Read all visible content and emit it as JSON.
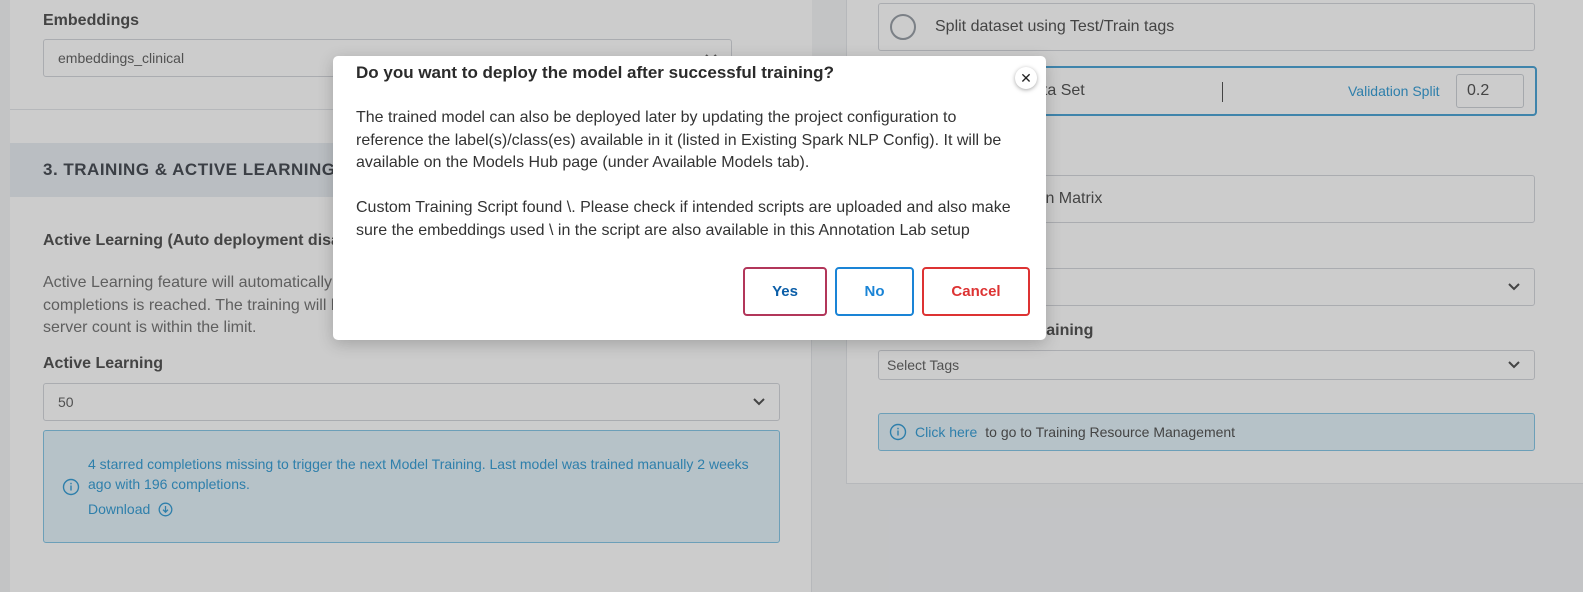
{
  "embeddings": {
    "label": "Embeddings",
    "value": "embeddings_clinical"
  },
  "training": {
    "section_title": "3. TRAINING & ACTIVE LEARNING",
    "active_learning_heading": "Active Learning  (Auto deployment disab",
    "description_lines": [
      "Active Learning feature will automatically",
      "completions is reached. The training will l",
      "server count is within the limit."
    ],
    "active_learning_label": "Active Learning",
    "active_learning_value": "50",
    "info_text": "4 starred completions missing to trigger the next Model Training. Last model was trained manually 2 weeks ago with 196 completions.",
    "download_label": "Download"
  },
  "right_panel": {
    "split_option_label": "Split dataset using Test/Train tags",
    "dataset_partial": "ata Set",
    "validation_split_label": "Validation Split",
    "validation_split_value": "0.2",
    "matrix_partial": "ion Matrix",
    "tags_heading_partial": "raining",
    "tags_placeholder": "Select Tags",
    "resource_link": "Click here",
    "resource_text": "to go to Training Resource Management"
  },
  "modal": {
    "title": "Do you want to deploy the model after successful training?",
    "paragraph1": "The trained model can also be deployed later by updating the project configuration to reference the label(s)/class(es) available in it (listed in Existing Spark NLP Config). It will be available on the Models Hub page (under Available Models tab).",
    "paragraph2": "Custom Training Script found \\. Please check if intended scripts are uploaded and also make sure the embeddings used \\ in the script are also available in this Annotation Lab setup",
    "close_glyph": "✕",
    "yes_label": "Yes",
    "no_label": "No",
    "cancel_label": "Cancel"
  },
  "colors": {
    "accent": "#3a9fd6",
    "danger": "#dd3333",
    "primary": "#1a84d6"
  }
}
